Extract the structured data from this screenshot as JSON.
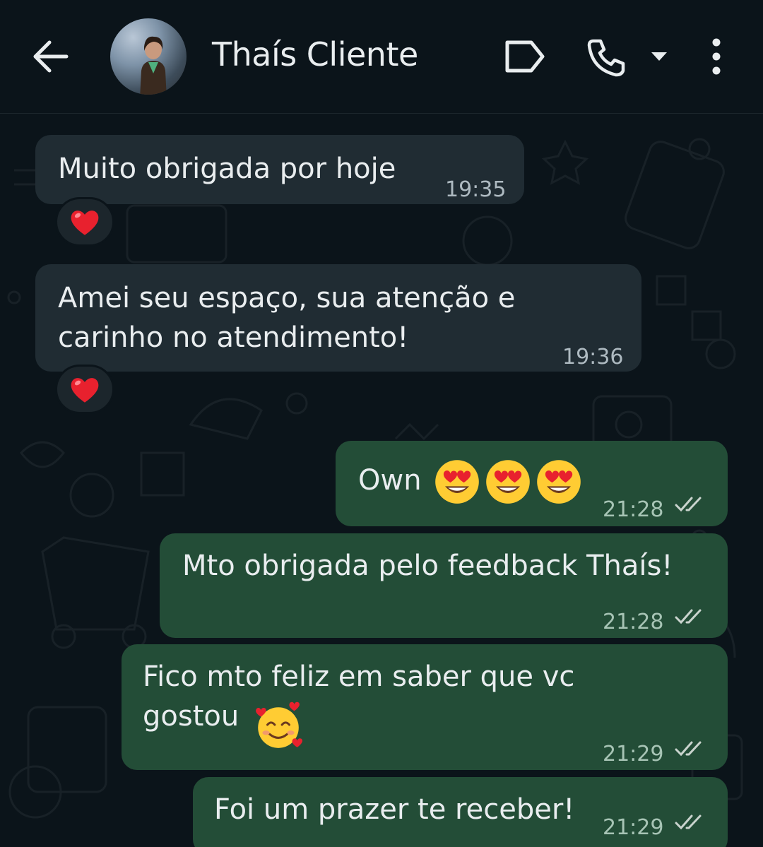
{
  "header": {
    "title": "Thaís Cliente",
    "back_icon": "arrow-left-icon",
    "label_icon": "label-icon",
    "call_icon": "phone-icon",
    "menu_icon": "more-vertical-icon"
  },
  "colors": {
    "background": "#0b141a",
    "incoming_bubble": "#202c33",
    "outgoing_bubble": "#234d37",
    "timestamp": "#aebac1"
  },
  "messages": [
    {
      "direction": "incoming",
      "text": "Muito obrigada por hoje",
      "time": "19:35",
      "reaction": "❤️"
    },
    {
      "direction": "incoming",
      "text": "Amei seu espaço, sua atenção e\ncarinho no atendimento!",
      "time": "19:36",
      "reaction": "❤️"
    },
    {
      "direction": "outgoing",
      "text": "Own",
      "emoji": "heart-eyes-emoji x3",
      "time": "21:28",
      "status": "read"
    },
    {
      "direction": "outgoing",
      "text": "Mto obrigada pelo feedback Thaís!",
      "time": "21:28",
      "status": "read"
    },
    {
      "direction": "outgoing",
      "text": "Fico mto feliz em saber que vc\ngostou",
      "emoji": "smiling-face-with-hearts-emoji",
      "time": "21:29",
      "status": "read"
    },
    {
      "direction": "outgoing",
      "text": "Foi um prazer te receber!",
      "time": "21:29",
      "status": "read"
    }
  ]
}
